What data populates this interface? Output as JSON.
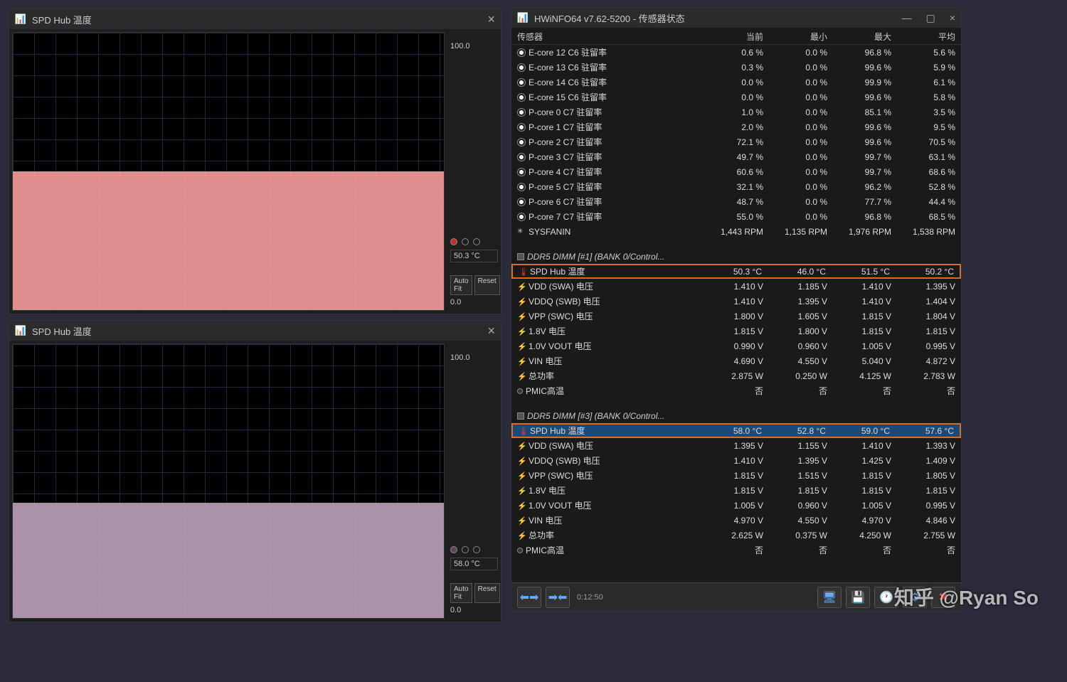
{
  "graph1": {
    "title": "SPD Hub 温度",
    "scale_max": "100.0",
    "scale_min": "0.0",
    "current": "50.3 °C",
    "auto_fit": "Auto Fit",
    "reset": "Reset"
  },
  "graph2": {
    "title": "SPD Hub 温度",
    "scale_max": "100.0",
    "scale_min": "0.0",
    "current": "58.0 °C",
    "auto_fit": "Auto Fit",
    "reset": "Reset"
  },
  "main": {
    "title": "HWiNFO64 v7.62-5200 - 传感器状态",
    "headers": {
      "sensor": "传感器",
      "current": "当前",
      "min": "最小",
      "max": "最大",
      "avg": "平均"
    },
    "timer": "0:12:50",
    "rows": [
      {
        "icon": "clock",
        "name": "E-core 12 C6 驻留率",
        "cur": "0.6 %",
        "min": "0.0 %",
        "max": "96.8 %",
        "avg": "5.6 %",
        "hl": true
      },
      {
        "icon": "clock",
        "name": "E-core 13 C6 驻留率",
        "cur": "0.3 %",
        "min": "0.0 %",
        "max": "99.6 %",
        "avg": "5.9 %"
      },
      {
        "icon": "clock",
        "name": "E-core 14 C6 驻留率",
        "cur": "0.0 %",
        "min": "0.0 %",
        "max": "99.9 %",
        "avg": "6.1 %",
        "hl": true
      },
      {
        "icon": "clock",
        "name": "E-core 15 C6 驻留率",
        "cur": "0.0 %",
        "min": "0.0 %",
        "max": "99.6 %",
        "avg": "5.8 %"
      },
      {
        "icon": "clock",
        "name": "P-core 0 C7 驻留率",
        "cur": "1.0 %",
        "min": "0.0 %",
        "max": "85.1 %",
        "avg": "3.5 %",
        "hl": true
      },
      {
        "icon": "clock",
        "name": "P-core 1 C7 驻留率",
        "cur": "2.0 %",
        "min": "0.0 %",
        "max": "99.6 %",
        "avg": "9.5 %"
      },
      {
        "icon": "clock",
        "name": "P-core 2 C7 驻留率",
        "cur": "72.1 %",
        "min": "0.0 %",
        "max": "99.6 %",
        "avg": "70.5 %",
        "hl": true
      },
      {
        "icon": "clock",
        "name": "P-core 3 C7 驻留率",
        "cur": "49.7 %",
        "min": "0.0 %",
        "max": "99.7 %",
        "avg": "63.1 %"
      },
      {
        "icon": "clock",
        "name": "P-core 4 C7 驻留率",
        "cur": "60.6 %",
        "min": "0.0 %",
        "max": "99.7 %",
        "avg": "68.6 %",
        "hl": true
      },
      {
        "icon": "clock",
        "name": "P-core 5 C7 驻留率",
        "cur": "32.1 %",
        "min": "0.0 %",
        "max": "96.2 %",
        "avg": "52.8 %"
      },
      {
        "icon": "clock",
        "name": "P-core 6 C7 驻留率",
        "cur": "48.7 %",
        "min": "0.0 %",
        "max": "77.7 %",
        "avg": "44.4 %",
        "hl": true
      },
      {
        "icon": "clock",
        "name": "P-core 7 C7 驻留率",
        "cur": "55.0 %",
        "min": "0.0 %",
        "max": "96.8 %",
        "avg": "68.5 %"
      },
      {
        "icon": "fan",
        "name": "SYSFANIN",
        "cur": "1,443 RPM",
        "min": "1,135 RPM",
        "max": "1,976 RPM",
        "avg": "1,538 RPM"
      },
      {
        "empty": true
      },
      {
        "icon": "chip",
        "name": "DDR5 DIMM [#1] (BANK 0/Control...",
        "cat": true
      },
      {
        "icon": "therm",
        "name": "SPD Hub 温度",
        "cur": "50.3 °C",
        "min": "46.0 °C",
        "max": "51.5 °C",
        "avg": "50.2 °C",
        "box": true
      },
      {
        "icon": "volt",
        "name": "VDD (SWA) 电压",
        "cur": "1.410 V",
        "min": "1.185 V",
        "max": "1.410 V",
        "avg": "1.395 V"
      },
      {
        "icon": "volt",
        "name": "VDDQ (SWB) 电压",
        "cur": "1.410 V",
        "min": "1.395 V",
        "max": "1.410 V",
        "avg": "1.404 V"
      },
      {
        "icon": "volt",
        "name": "VPP (SWC) 电压",
        "cur": "1.800 V",
        "min": "1.605 V",
        "max": "1.815 V",
        "avg": "1.804 V"
      },
      {
        "icon": "volt",
        "name": "1.8V 电压",
        "cur": "1.815 V",
        "min": "1.800 V",
        "max": "1.815 V",
        "avg": "1.815 V"
      },
      {
        "icon": "volt",
        "name": "1.0V VOUT 电压",
        "cur": "0.990 V",
        "min": "0.960 V",
        "max": "1.005 V",
        "avg": "0.995 V",
        "hl": true
      },
      {
        "icon": "volt",
        "name": "VIN 电压",
        "cur": "4.690 V",
        "min": "4.550 V",
        "max": "5.040 V",
        "avg": "4.872 V"
      },
      {
        "icon": "volt",
        "name": "总功率",
        "cur": "2.875 W",
        "min": "0.250 W",
        "max": "4.125 W",
        "avg": "2.783 W"
      },
      {
        "icon": "off",
        "name": "PMIC高温",
        "cur": "否",
        "min": "否",
        "max": "否",
        "avg": "否"
      },
      {
        "empty": true
      },
      {
        "icon": "chip",
        "name": "DDR5 DIMM [#3] (BANK 0/Control...",
        "cat": true
      },
      {
        "icon": "therm",
        "name": "SPD Hub 温度",
        "cur": "58.0 °C",
        "min": "52.8 °C",
        "max": "59.0 °C",
        "avg": "57.6 °C",
        "box": true,
        "sel": true
      },
      {
        "icon": "volt",
        "name": "VDD (SWA) 电压",
        "cur": "1.395 V",
        "min": "1.155 V",
        "max": "1.410 V",
        "avg": "1.393 V"
      },
      {
        "icon": "volt",
        "name": "VDDQ (SWB) 电压",
        "cur": "1.410 V",
        "min": "1.395 V",
        "max": "1.425 V",
        "avg": "1.409 V"
      },
      {
        "icon": "volt",
        "name": "VPP (SWC) 电压",
        "cur": "1.815 V",
        "min": "1.515 V",
        "max": "1.815 V",
        "avg": "1.805 V"
      },
      {
        "icon": "volt",
        "name": "1.8V 电压",
        "cur": "1.815 V",
        "min": "1.815 V",
        "max": "1.815 V",
        "avg": "1.815 V"
      },
      {
        "icon": "volt",
        "name": "1.0V VOUT 电压",
        "cur": "1.005 V",
        "min": "0.960 V",
        "max": "1.005 V",
        "avg": "0.995 V",
        "hl": true
      },
      {
        "icon": "volt",
        "name": "VIN 电压",
        "cur": "4.970 V",
        "min": "4.550 V",
        "max": "4.970 V",
        "avg": "4.846 V"
      },
      {
        "icon": "volt",
        "name": "总功率",
        "cur": "2.625 W",
        "min": "0.375 W",
        "max": "4.250 W",
        "avg": "2.755 W"
      },
      {
        "icon": "off",
        "name": "PMIC高温",
        "cur": "否",
        "min": "否",
        "max": "否",
        "avg": "否"
      }
    ]
  },
  "watermark": "知乎 @Ryan So"
}
